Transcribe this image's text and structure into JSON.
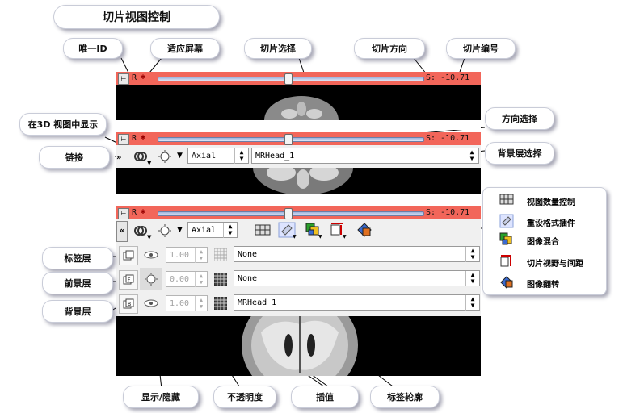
{
  "title": "切片视图控制",
  "callouts": {
    "unique_id": "唯一ID",
    "fit": "适应屏幕",
    "slice_select": "切片选择",
    "slice_orient": "切片方向",
    "slice_number": "切片编号",
    "show_3d": "在3D 视图中显示",
    "orient_select": "方向选择",
    "link": "链接",
    "bg_select": "背景层选择",
    "label_layer": "标签层",
    "fg_layer": "前景层",
    "bg_layer": "背景层",
    "show_hide": "显示/隐藏",
    "opacity": "不透明度",
    "interp": "插值",
    "label_outline": "标签轮廓"
  },
  "legend": [
    {
      "label": "视图数量控制",
      "icon": "view-layout-icon"
    },
    {
      "label": "重设格式插件",
      "icon": "reformat-widget-icon"
    },
    {
      "label": "图像混合",
      "icon": "compositing-icon"
    },
    {
      "label": "切片视野与间距",
      "icon": "slice-spacing-icon"
    },
    {
      "label": "图像翻转",
      "icon": "rotate-to-volume-plane-icon"
    }
  ],
  "controller": {
    "id_letter": "R",
    "offset_text": "S: -10.71",
    "slider_fraction": 0.49,
    "orientation": "Axial",
    "background_volume": "MRHead_1",
    "collapse_label": "«",
    "layers": [
      {
        "name": "label",
        "opacity": "1.00",
        "volume": "None"
      },
      {
        "name": "foreground",
        "opacity": "0.00",
        "volume": "None"
      },
      {
        "name": "background",
        "opacity": "1.00",
        "volume": "MRHead_1"
      }
    ]
  },
  "colors": {
    "bar": "#f2665a",
    "accent": "#3d5fa8"
  }
}
